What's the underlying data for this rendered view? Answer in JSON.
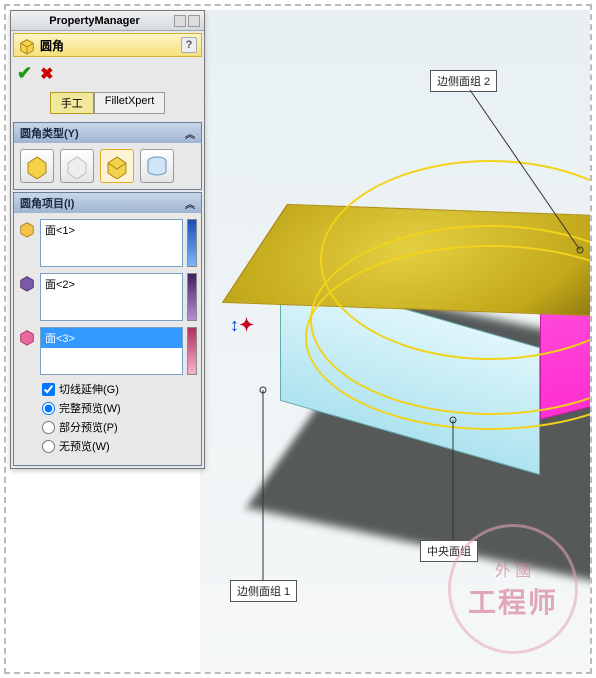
{
  "panel": {
    "title": "PropertyManager",
    "feature_name": "圆角",
    "help_char": "?",
    "ok_char": "✔",
    "cancel_char": "✖",
    "mode_manual": "手工",
    "mode_filletxpert": "FilletXpert"
  },
  "type_section": {
    "title": "圆角类型(Y)"
  },
  "items_section": {
    "title": "圆角项目(I)",
    "faces": [
      {
        "label": "面<1>",
        "selected": false
      },
      {
        "label": "面<2>",
        "selected": false
      },
      {
        "label": "面<3>",
        "selected": true
      }
    ]
  },
  "options": {
    "tangent": "切线延伸(G)",
    "full_preview": "完整预览(W)",
    "partial_preview": "部分预览(P)",
    "no_preview": "无预览(W)"
  },
  "callouts": {
    "side_group_2": "边侧面组 2",
    "side_group_1": "边侧面组 1",
    "center_group": "中央面组"
  },
  "watermark": {
    "line1": "外 國",
    "line2": "工程师"
  }
}
